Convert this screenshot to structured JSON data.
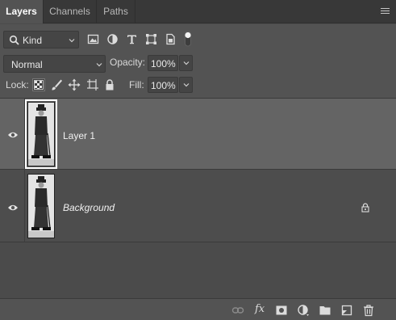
{
  "tabs": [
    {
      "label": "Layers",
      "active": true
    },
    {
      "label": "Channels",
      "active": false
    },
    {
      "label": "Paths",
      "active": false
    }
  ],
  "filter": {
    "kind_label": "Kind",
    "icons": [
      "pixel-filter-icon",
      "adjustment-filter-icon",
      "type-filter-icon",
      "shape-filter-icon",
      "smart-object-filter-icon",
      "filter-toggle-icon"
    ]
  },
  "blend": {
    "mode": "Normal",
    "opacity_label": "Opacity:",
    "opacity_value": "100%"
  },
  "lock": {
    "label": "Lock:",
    "fill_label": "Fill:",
    "fill_value": "100%",
    "icons": [
      "lock-transparent-pixels-icon",
      "lock-image-pixels-icon",
      "lock-position-icon",
      "lock-artboard-icon",
      "lock-all-icon"
    ]
  },
  "layers": [
    {
      "name": "Layer 1",
      "visible": true,
      "selected": true,
      "italic": false,
      "locked": false
    },
    {
      "name": "Background",
      "visible": true,
      "selected": false,
      "italic": true,
      "locked": true
    }
  ],
  "footer_icons": [
    "link-layers-icon",
    "fx-icon",
    "add-mask-icon",
    "adjustment-layer-icon",
    "group-folder-icon",
    "new-layer-icon",
    "trash-icon"
  ],
  "footer": {
    "fx_label": "fx"
  },
  "colors": {
    "panel_bg": "#535353",
    "tab_bg": "#383838",
    "selected_row": "#646464",
    "text": "#e0e0e0"
  }
}
